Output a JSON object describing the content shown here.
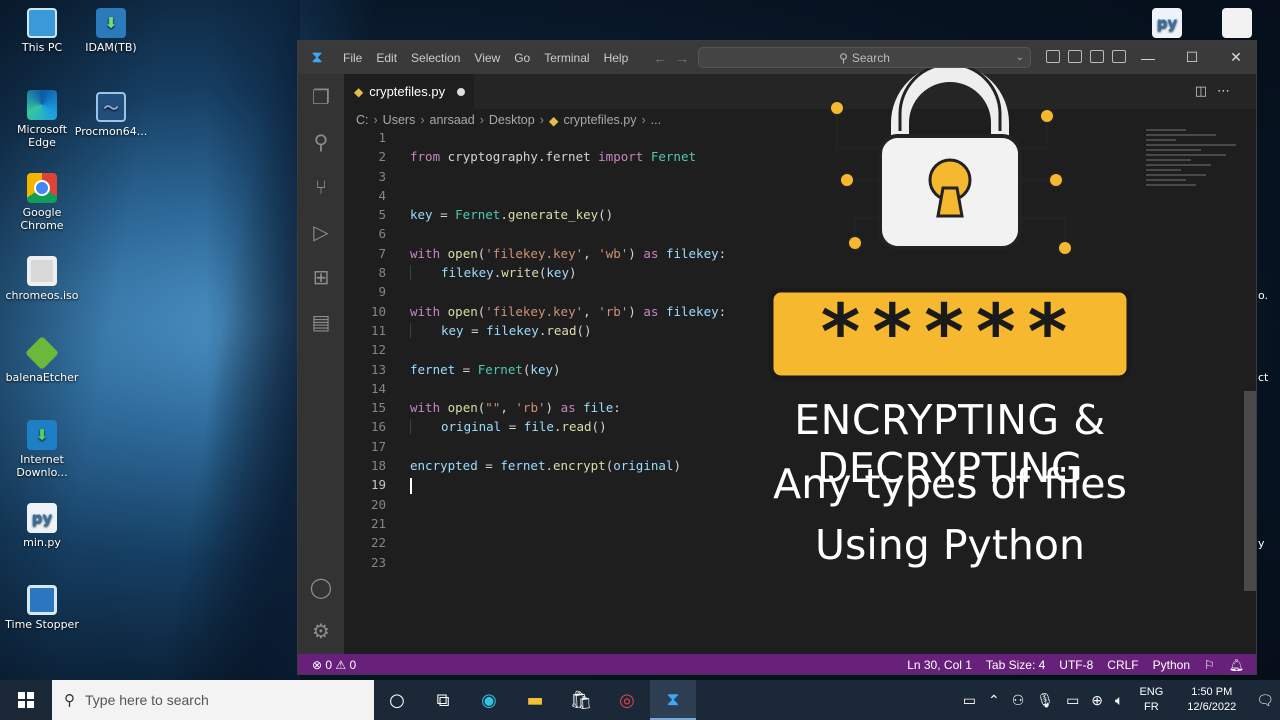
{
  "desktop": {
    "icons": [
      {
        "label": "This PC",
        "icon": "computer-icon"
      },
      {
        "label": "IDAM(TB)",
        "icon": "idm-icon"
      },
      {
        "label": "Microsoft Edge",
        "icon": "edge-icon"
      },
      {
        "label": "Procmon64...",
        "icon": "procmon-icon"
      },
      {
        "label": "Google Chrome",
        "icon": "chrome-icon"
      },
      {
        "label": "chromeos.iso",
        "icon": "disc-icon"
      },
      {
        "label": "balenaEtcher",
        "icon": "balena-icon"
      },
      {
        "label": "Internet Downlo...",
        "icon": "idm-icon"
      },
      {
        "label": "min.py",
        "icon": "python-file-icon"
      },
      {
        "label": "Time Stopper",
        "icon": "timer-icon"
      }
    ],
    "right_fragments": [
      "o.",
      "ct",
      "y"
    ]
  },
  "vscode": {
    "menu": [
      "File",
      "Edit",
      "Selection",
      "View",
      "Go",
      "Terminal",
      "Help"
    ],
    "search_placeholder": "Search",
    "tab": {
      "filename": "cryptefiles.py"
    },
    "breadcrumb": [
      "C:",
      "Users",
      "anrsaad",
      "Desktop",
      "cryptefiles.py",
      "..."
    ],
    "code_lines": [
      {
        "n": "1",
        "parts": []
      },
      {
        "n": "2",
        "parts": [
          [
            "kw",
            "from "
          ],
          [
            "plain",
            "cryptography.fernet "
          ],
          [
            "kw",
            "import "
          ],
          [
            "cls",
            "Fernet"
          ]
        ]
      },
      {
        "n": "3",
        "parts": []
      },
      {
        "n": "4",
        "parts": []
      },
      {
        "n": "5",
        "parts": [
          [
            "var",
            "key"
          ],
          [
            "plain",
            " = "
          ],
          [
            "cls",
            "Fernet"
          ],
          [
            "plain",
            "."
          ],
          [
            "fn",
            "generate_key"
          ],
          [
            "plain",
            "()"
          ]
        ]
      },
      {
        "n": "6",
        "parts": []
      },
      {
        "n": "7",
        "parts": [
          [
            "kw",
            "with "
          ],
          [
            "fn",
            "open"
          ],
          [
            "plain",
            "("
          ],
          [
            "str",
            "'filekey.key'"
          ],
          [
            "plain",
            ", "
          ],
          [
            "str",
            "'wb'"
          ],
          [
            "plain",
            ") "
          ],
          [
            "kw",
            "as "
          ],
          [
            "var",
            "filekey"
          ],
          [
            "plain",
            ":"
          ]
        ]
      },
      {
        "n": "8",
        "indent": true,
        "parts": [
          [
            "var",
            "filekey"
          ],
          [
            "plain",
            "."
          ],
          [
            "fn",
            "write"
          ],
          [
            "plain",
            "("
          ],
          [
            "var",
            "key"
          ],
          [
            "plain",
            ")"
          ]
        ]
      },
      {
        "n": "9",
        "parts": []
      },
      {
        "n": "10",
        "parts": [
          [
            "kw",
            "with "
          ],
          [
            "fn",
            "open"
          ],
          [
            "plain",
            "("
          ],
          [
            "str",
            "'filekey.key'"
          ],
          [
            "plain",
            ", "
          ],
          [
            "str",
            "'rb'"
          ],
          [
            "plain",
            ") "
          ],
          [
            "kw",
            "as "
          ],
          [
            "var",
            "filekey"
          ],
          [
            "plain",
            ":"
          ]
        ]
      },
      {
        "n": "11",
        "indent": true,
        "parts": [
          [
            "var",
            "key"
          ],
          [
            "plain",
            " = "
          ],
          [
            "var",
            "filekey"
          ],
          [
            "plain",
            "."
          ],
          [
            "fn",
            "read"
          ],
          [
            "plain",
            "()"
          ]
        ]
      },
      {
        "n": "12",
        "parts": []
      },
      {
        "n": "13",
        "parts": [
          [
            "var",
            "fernet"
          ],
          [
            "plain",
            " = "
          ],
          [
            "cls",
            "Fernet"
          ],
          [
            "plain",
            "("
          ],
          [
            "var",
            "key"
          ],
          [
            "plain",
            ")"
          ]
        ]
      },
      {
        "n": "14",
        "parts": []
      },
      {
        "n": "15",
        "parts": [
          [
            "kw",
            "with "
          ],
          [
            "fn",
            "open"
          ],
          [
            "plain",
            "("
          ],
          [
            "str",
            "\"\""
          ],
          [
            "plain",
            ", "
          ],
          [
            "str",
            "'rb'"
          ],
          [
            "plain",
            ") "
          ],
          [
            "kw",
            "as "
          ],
          [
            "var",
            "file"
          ],
          [
            "plain",
            ":"
          ]
        ]
      },
      {
        "n": "16",
        "indent": true,
        "parts": [
          [
            "var",
            "original"
          ],
          [
            "plain",
            " = "
          ],
          [
            "var",
            "file"
          ],
          [
            "plain",
            "."
          ],
          [
            "fn",
            "read"
          ],
          [
            "plain",
            "()"
          ]
        ]
      },
      {
        "n": "17",
        "parts": []
      },
      {
        "n": "18",
        "parts": [
          [
            "var",
            "encrypted"
          ],
          [
            "plain",
            " = "
          ],
          [
            "var",
            "fernet"
          ],
          [
            "plain",
            "."
          ],
          [
            "fn",
            "encrypt"
          ],
          [
            "plain",
            "("
          ],
          [
            "var",
            "original"
          ],
          [
            "plain",
            ")"
          ]
        ]
      },
      {
        "n": "19",
        "cursor": true,
        "parts": []
      },
      {
        "n": "20",
        "parts": []
      },
      {
        "n": "21",
        "parts": []
      },
      {
        "n": "22",
        "parts": []
      },
      {
        "n": "23",
        "parts": []
      }
    ],
    "status": {
      "errors": "⊗ 0 ⚠ 0",
      "position": "Ln 30, Col 1",
      "tab_size": "Tab Size: 4",
      "encoding": "UTF-8",
      "eol": "CRLF",
      "language": "Python"
    }
  },
  "overlay": {
    "line1": "ENCRYPTING & DECRYPTING",
    "line2": "Any types of files",
    "line3": "Using Python",
    "password_mask": "*****",
    "accent_color": "#f5b82e"
  },
  "taskbar": {
    "search_placeholder": "Type here to search",
    "lang_top": "ENG",
    "lang_bottom": "FR",
    "time": "1:50 PM",
    "date": "12/6/2022"
  }
}
